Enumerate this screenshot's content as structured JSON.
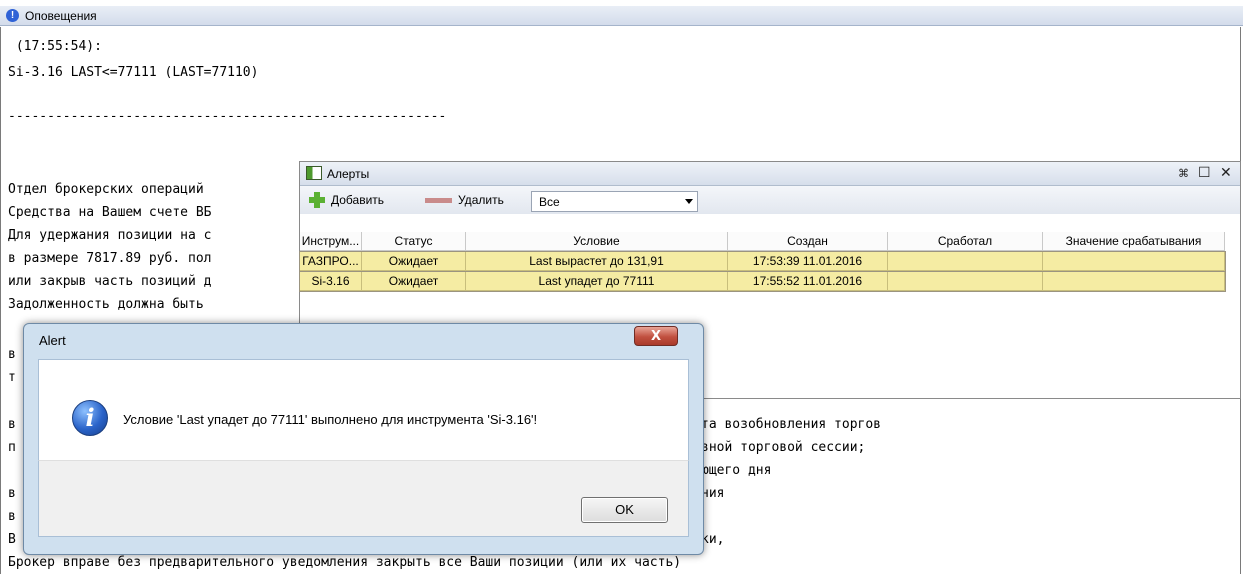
{
  "notifications": {
    "title": "Оповещения",
    "lines": [
      " (17:55:54):",
      "Si-3.16 LAST<=77111 (LAST=77110)",
      "",
      "--------------------------------------------------------",
      "",
      "",
      "Отдел брокерских операций",
      "Средства на Вашем счете ВБ",
      "Для удержания позиции на с",
      "в размере 7817.89 руб. пол",
      "или закрыв часть позиций д",
      "Задолженность должна быть"
    ],
    "fragments": [
      "в",
      "т",
      "в",
      "п",
      "в",
      "в",
      "В"
    ],
    "right_lines": [
      "та возобновления торгов",
      "вной торговой сессии;",
      "ющего дня",
      "ния"
    ],
    "right_fragment_ki": "ки,",
    "bottom_line": "Брокер вправе без предварительного уведомления закрыть все Ваши позиции (или их часть)"
  },
  "alerts_panel": {
    "title": "Алерты",
    "add_label": "Добавить",
    "delete_label": "Удалить",
    "filter_value": "Все",
    "columns": [
      "Инструм...",
      "Статус",
      "Условие",
      "Создан",
      "Сработал",
      "Значение срабатывания"
    ],
    "rows": [
      [
        "ГАЗПРО...",
        "Ожидает",
        "Last вырастет до 131,91",
        "17:53:39 11.01.2016",
        "",
        ""
      ],
      [
        "Si-3.16",
        "Ожидает",
        "Last упадет до 77111",
        "17:55:52 11.01.2016",
        "",
        ""
      ]
    ]
  },
  "dialog": {
    "title": "Alert",
    "close_label": "X",
    "message": "Условие 'Last упадет до 77111' выполнено для инструмента 'Si-3.16'!",
    "ok_label": "OK"
  }
}
